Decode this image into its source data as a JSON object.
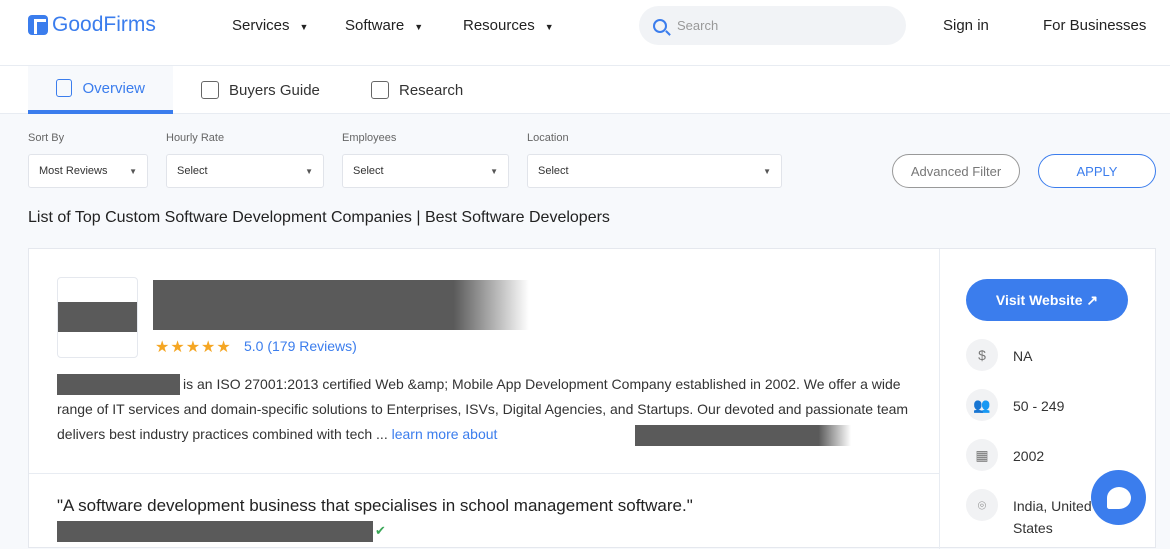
{
  "header": {
    "brand": "GoodFirms",
    "nav": [
      "Services",
      "Software",
      "Resources"
    ],
    "search_placeholder": "Search",
    "sign_in": "Sign in",
    "for_businesses": "For Businesses"
  },
  "tabs": [
    "Overview",
    "Buyers Guide",
    "Research"
  ],
  "filters": {
    "sort_label": "Sort By",
    "sort_value": "Most Reviews",
    "rate_label": "Hourly Rate",
    "rate_value": "Select",
    "emp_label": "Employees",
    "emp_value": "Select",
    "loc_label": "Location",
    "loc_value": "Select",
    "advanced": "Advanced Filter",
    "apply": "APPLY"
  },
  "list_title": "List of Top Custom Software Development Companies | Best Software Developers",
  "company": {
    "stars": "★★★★★",
    "rating": "5.0 (179 Reviews)",
    "description": "is an ISO 27001:2013 certified Web &amp; Mobile App Development Company established in 2002. We offer a wide range of IT services and domain-specific solutions to Enterprises, ISVs, Digital Agencies, and Startups. Our devoted and passionate team delivers best industry practices combined with tech ...",
    "learn_more": "learn more about",
    "quote": "\"A software development business that specialises in school management software.\"",
    "visit": "Visit Website ↗",
    "rate": "NA",
    "employees": "50 - 249",
    "founded": "2002",
    "location": "India, United States"
  }
}
